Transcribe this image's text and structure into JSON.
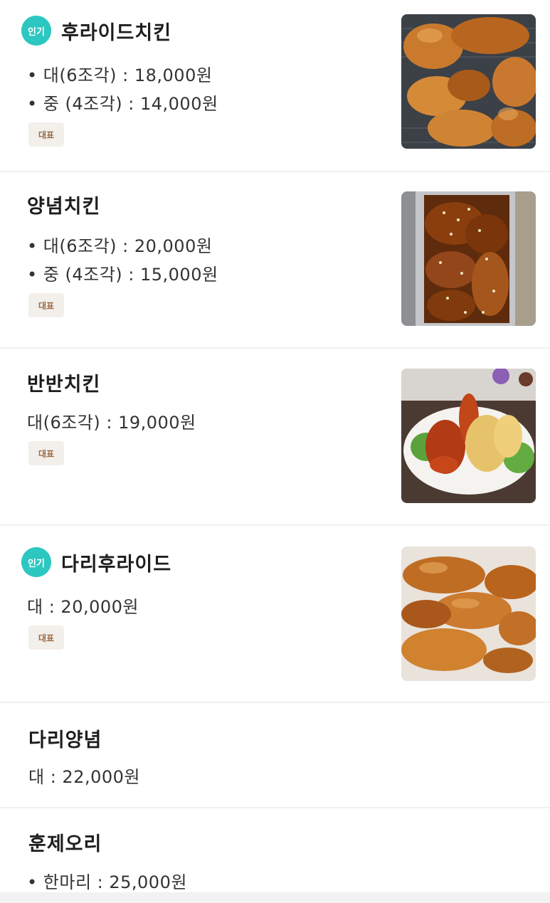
{
  "items": [
    {
      "name": "후라이드치킨",
      "popular_badge": "인기",
      "prices": [
        "• 대(6조각) : 18,000원",
        "• 중 (4조각) : 14,000원"
      ],
      "rep_badge": "대표",
      "image": "fried-chicken-photo"
    },
    {
      "name": "양념치킨",
      "prices": [
        "• 대(6조각) : 20,000원",
        "• 중 (4조각) : 15,000원"
      ],
      "rep_badge": "대표",
      "image": "yangnyeom-chicken-photo"
    },
    {
      "name": "반반치킨",
      "prices": [
        "대(6조각) : 19,000원"
      ],
      "rep_badge": "대표",
      "image": "half-half-chicken-photo"
    },
    {
      "name": "다리후라이드",
      "popular_badge": "인기",
      "prices": [
        "대 : 20,000원"
      ],
      "rep_badge": "대표",
      "image": "drumstick-fried-photo"
    },
    {
      "name": "다리양념",
      "prices": [
        "대 : 22,000원"
      ]
    },
    {
      "name": "훈제오리",
      "prices": [
        "• 한마리 : 25,000원"
      ]
    }
  ],
  "colors": {
    "popular_badge": "#2cc7c0",
    "rep_badge_bg": "#f3efea",
    "rep_badge_text": "#9a6b47",
    "divider": "#f1f1f1"
  }
}
